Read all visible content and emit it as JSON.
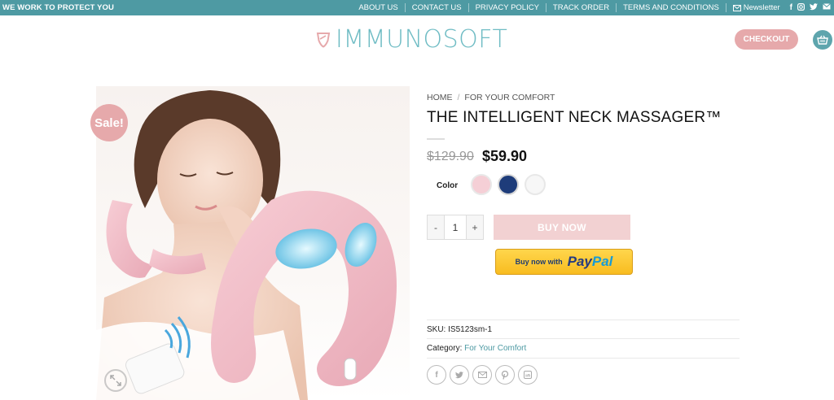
{
  "topbar": {
    "tagline": "WE WORK TO PROTECT YOU",
    "nav": [
      "ABOUT US",
      "CONTACT US",
      "PRIVACY POLICY",
      "TRACK ORDER",
      "TERMS AND CONDITIONS"
    ],
    "newsletter": "Newsletter",
    "social": [
      "facebook-icon",
      "instagram-icon",
      "twitter-icon",
      "email-icon"
    ]
  },
  "header": {
    "logo_text": "IMMUNOSOFT",
    "checkout_label": "CHECKOUT",
    "cart_icon": "basket-icon"
  },
  "product": {
    "sale_badge": "Sale!",
    "breadcrumb": [
      "HOME",
      "FOR YOUR COMFORT"
    ],
    "breadcrumb_sep": "/",
    "title": "THE INTELLIGENT NECK MASSAGER™",
    "price_old": "$129.90",
    "price_new": "$59.90",
    "color_label": "Color",
    "colors": [
      "#f5cfd6",
      "#1e3c7a",
      "#f7f7f7"
    ],
    "quantity": "1",
    "qty_minus": "-",
    "qty_plus": "+",
    "buy_now_label": "BUY NOW",
    "paypal_pre": "Buy now with",
    "paypal_brand_1": "Pay",
    "paypal_brand_2": "Pal",
    "sku_label": "SKU:",
    "sku": "IS5123sm-1",
    "category_label": "Category:",
    "category": "For Your Comfort",
    "share_icons": [
      "facebook-icon",
      "twitter-icon",
      "email-icon",
      "pinterest-icon",
      "linkedin-icon"
    ]
  },
  "colors": {
    "topbar": "#4e9aa3",
    "accent_pink": "#e6a9ab",
    "logo": "#6fbcc4"
  }
}
